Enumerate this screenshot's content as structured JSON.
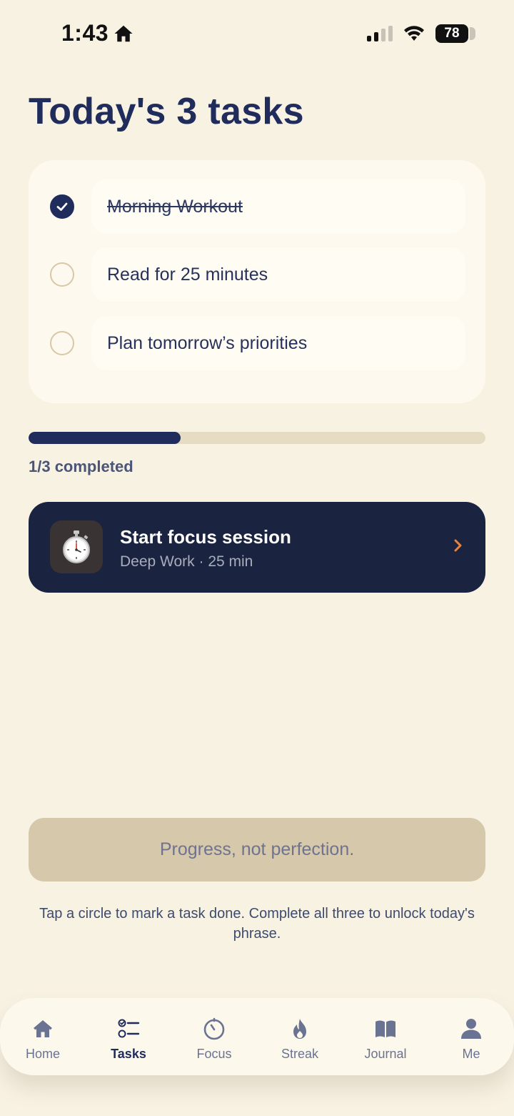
{
  "status_bar": {
    "time": "1:43",
    "battery": "78"
  },
  "page": {
    "title": "Today's 3 tasks"
  },
  "tasks": [
    {
      "label": "Morning Workout",
      "done": true
    },
    {
      "label": "Read for 25 minutes",
      "done": false
    },
    {
      "label": "Plan tomorrow’s priorities",
      "done": false
    }
  ],
  "progress": {
    "fraction": 0.333,
    "label": "1/3 completed"
  },
  "focus": {
    "title": "Start focus session",
    "subtitle": "Deep Work · 25 min",
    "icon": "stopwatch-icon"
  },
  "quote": {
    "text": "Progress, not perfection."
  },
  "hint": {
    "text": "Tap a circle to mark a task done. Complete all three to unlock today's phrase."
  },
  "tab_bar": {
    "items": [
      {
        "label": "Home",
        "icon": "home-icon"
      },
      {
        "label": "Tasks",
        "icon": "tasks-icon",
        "active": true
      },
      {
        "label": "Focus",
        "icon": "focus-icon"
      },
      {
        "label": "Streak",
        "icon": "flame-icon"
      },
      {
        "label": "Journal",
        "icon": "book-icon"
      },
      {
        "label": "Me",
        "icon": "person-icon"
      }
    ]
  },
  "colors": {
    "background": "#f8f2e3",
    "primary": "#1f2c5c",
    "accent": "#e8833a",
    "quote_bg": "#d6c8aa"
  }
}
